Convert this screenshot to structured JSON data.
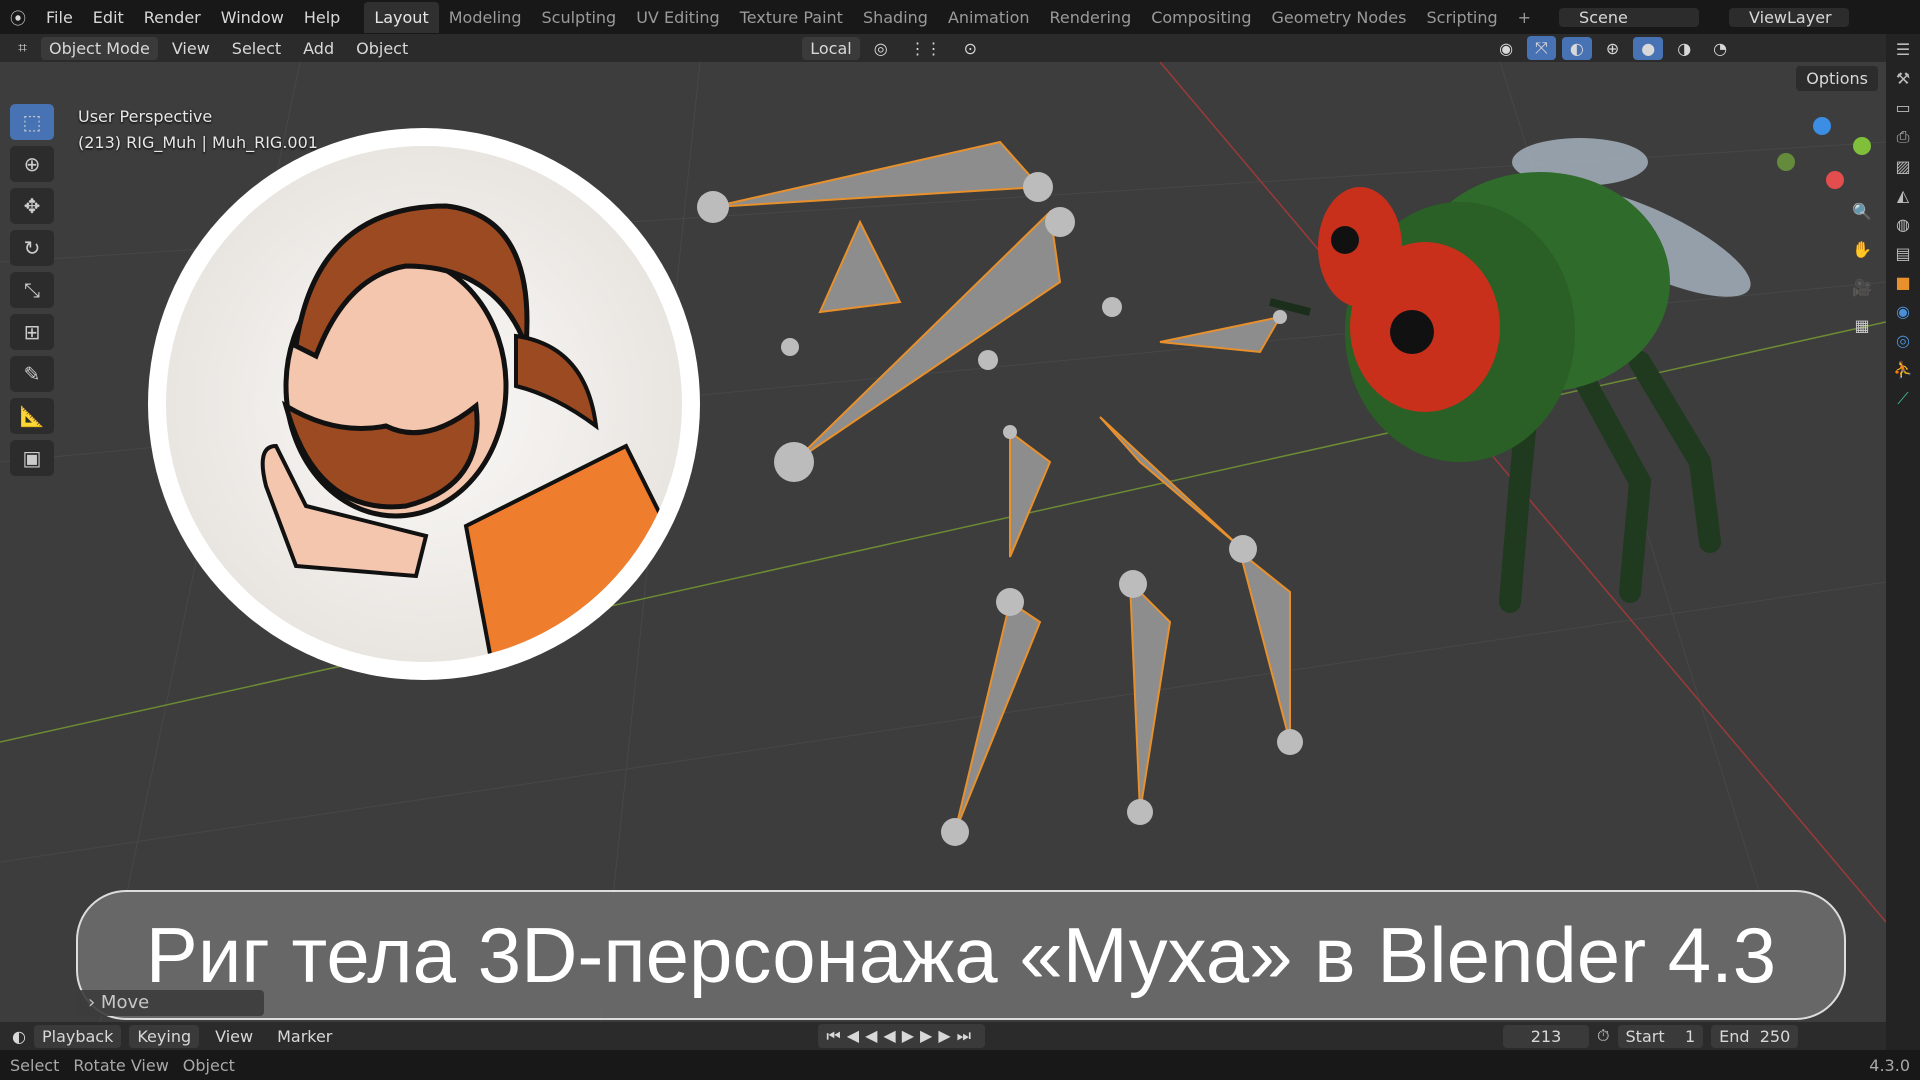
{
  "menu": [
    "File",
    "Edit",
    "Render",
    "Window",
    "Help"
  ],
  "workspaces": [
    "Layout",
    "Modeling",
    "Sculpting",
    "UV Editing",
    "Texture Paint",
    "Shading",
    "Animation",
    "Rendering",
    "Compositing",
    "Geometry Nodes",
    "Scripting",
    "+"
  ],
  "scene": "Scene",
  "view_layer": "ViewLayer",
  "header": {
    "mode": "Object Mode",
    "items": [
      "View",
      "Select",
      "Add",
      "Object"
    ],
    "transform": "Local",
    "options": "Options"
  },
  "viewport": {
    "perspective": "User Perspective",
    "object": "(213) RIG_Muh | Muh_RIG.001",
    "last_op": "Move"
  },
  "banner": "Риг тела 3D-персонажа «Муха» в Blender 4.3",
  "timeline": {
    "items": [
      "Playback",
      "Keying",
      "View",
      "Marker"
    ],
    "frame": "213",
    "start_label": "Start",
    "start": "1",
    "end_label": "End",
    "end": "250"
  },
  "status": {
    "items": [
      "Select",
      "Rotate View",
      "Object"
    ],
    "version": "4.3.0"
  },
  "colors": {
    "accent": "#4772b3",
    "bone_outline": "#e8902c",
    "fly_body": "#2f6b2a",
    "fly_eye": "#c8301c"
  }
}
